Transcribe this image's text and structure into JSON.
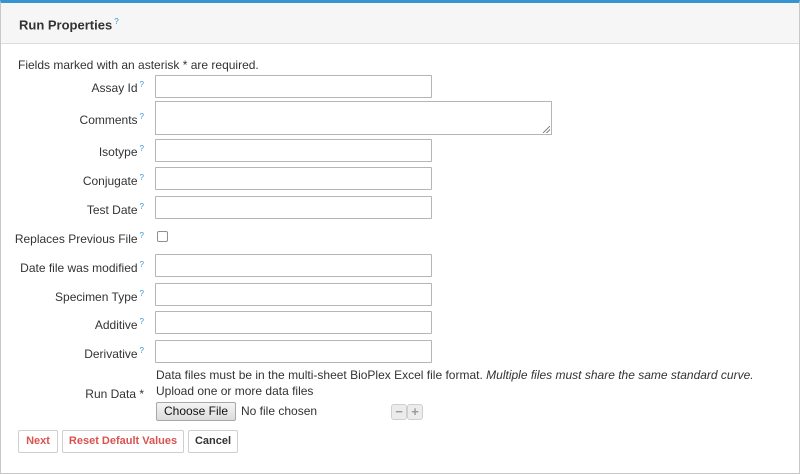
{
  "panel": {
    "title": "Run Properties",
    "help_mark": "?"
  },
  "required_note": "Fields marked with an asterisk * are required.",
  "fields": {
    "assay_id": {
      "label": "Assay Id",
      "value": ""
    },
    "comments": {
      "label": "Comments",
      "value": ""
    },
    "isotype": {
      "label": "Isotype",
      "value": ""
    },
    "conjugate": {
      "label": "Conjugate",
      "value": ""
    },
    "test_date": {
      "label": "Test Date",
      "value": ""
    },
    "replaces_previous_file": {
      "label": "Replaces Previous File",
      "checked": false
    },
    "date_file_modified": {
      "label": "Date file was modified",
      "value": ""
    },
    "specimen_type": {
      "label": "Specimen Type",
      "value": ""
    },
    "additive": {
      "label": "Additive",
      "value": ""
    },
    "derivative": {
      "label": "Derivative",
      "value": ""
    }
  },
  "run_data": {
    "label": "Run Data *",
    "format_note": "Data files must be in the multi-sheet BioPlex Excel file format.",
    "format_note_emphasis": "Multiple files must share the same standard curve.",
    "upload_note": "Upload one or more data files",
    "choose_file_label": "Choose File",
    "no_file_text": "No file chosen",
    "remove_symbol": "−",
    "add_symbol": "+"
  },
  "actions": {
    "next": "Next",
    "reset": "Reset Default Values",
    "cancel": "Cancel"
  },
  "colors": {
    "accent_blue": "#3495d2",
    "primary_button_text": "#d9534f"
  }
}
